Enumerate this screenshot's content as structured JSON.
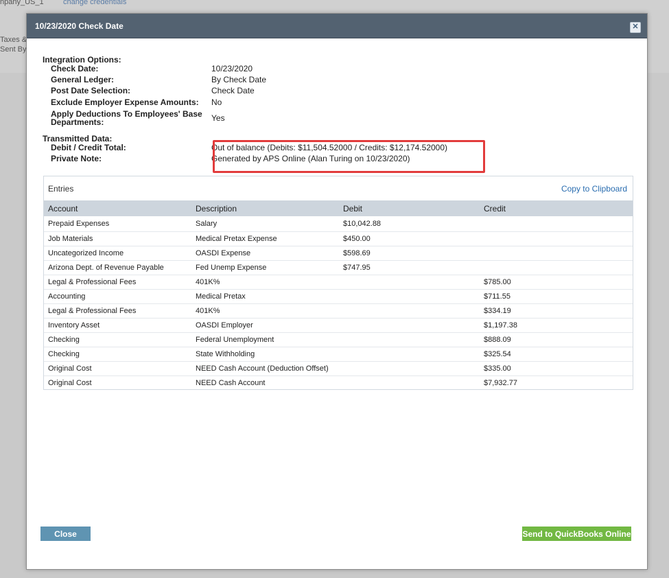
{
  "background": {
    "company_fragment": "npany_US_1",
    "credentials_link": "change credentials",
    "taxes_fragment": "Taxes &",
    "sent_fragment": "Sent By"
  },
  "modal": {
    "title": "10/23/2020 Check Date",
    "close_icon": "close-icon"
  },
  "integration": {
    "title": "Integration Options:",
    "rows": [
      {
        "label": "Check Date:",
        "value": "10/23/2020"
      },
      {
        "label": "General Ledger:",
        "value": "By Check Date"
      },
      {
        "label": "Post Date Selection:",
        "value": "Check Date"
      },
      {
        "label": "Exclude Employer Expense Amounts:",
        "value": "No"
      },
      {
        "label": "Apply Deductions To Employees' Base Departments:",
        "value": "Yes"
      }
    ]
  },
  "transmitted": {
    "title": "Transmitted Data:",
    "rows": [
      {
        "label": "Debit / Credit Total:",
        "value": "Out of balance (Debits: $11,504.52000 / Credits: $12,174.52000)"
      },
      {
        "label": "Private Note:",
        "value": "Generated by APS Online (Alan Turing on 10/23/2020)"
      }
    ]
  },
  "entries": {
    "title": "Entries",
    "copy_label": "Copy to Clipboard",
    "columns": [
      "Account",
      "Description",
      "Debit",
      "Credit"
    ],
    "rows": [
      [
        "Prepaid Expenses",
        "Salary",
        "$10,042.88",
        ""
      ],
      [
        "Job Materials",
        "Medical Pretax Expense",
        "$450.00",
        ""
      ],
      [
        "Uncategorized Income",
        "OASDI Expense",
        "$598.69",
        ""
      ],
      [
        "Arizona Dept. of Revenue Payable",
        "Fed Unemp Expense",
        "$747.95",
        ""
      ],
      [
        "Legal & Professional Fees",
        "401K%",
        "",
        "$785.00"
      ],
      [
        "Accounting",
        "Medical Pretax",
        "",
        "$711.55"
      ],
      [
        "Legal & Professional Fees",
        "401K%",
        "",
        "$334.19"
      ],
      [
        "Inventory Asset",
        "OASDI Employer",
        "",
        "$1,197.38"
      ],
      [
        "Checking",
        "Federal Unemployment",
        "",
        "$888.09"
      ],
      [
        "Checking",
        "State Withholding",
        "",
        "$325.54"
      ],
      [
        "Original Cost",
        "NEED Cash Account (Deduction Offset)",
        "",
        "$335.00"
      ],
      [
        "Original Cost",
        "NEED Cash Account",
        "",
        "$7,932.77"
      ]
    ]
  },
  "buttons": {
    "close": "Close",
    "send": "Send to QuickBooks Online"
  },
  "colors": {
    "header_bg": "#536271",
    "highlight_box": "#e23c3c",
    "close_button": "#5f94b2",
    "send_button": "#72b843",
    "link": "#2a6db0"
  }
}
